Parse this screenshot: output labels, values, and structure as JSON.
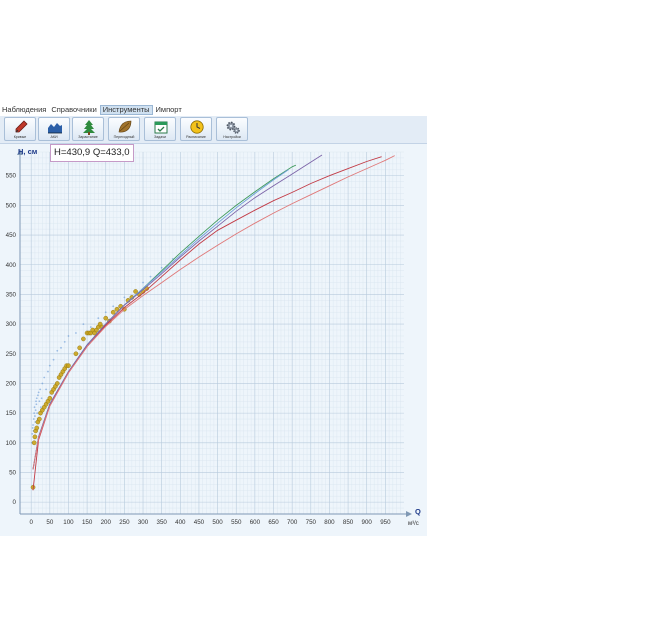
{
  "menu": {
    "items": [
      "Наблюдения",
      "Справочники",
      "Инструменты",
      "Импорт"
    ],
    "active_index": 2
  },
  "toolbar": {
    "buttons": [
      {
        "label": "Кривые",
        "icon": "pencil-icon"
      },
      {
        "label": "АКИ",
        "icon": "area-chart-icon"
      },
      {
        "label": "Зарастание",
        "icon": "tree-icon"
      },
      {
        "label": "Переходный",
        "icon": "leaf-icon"
      },
      {
        "label": "Задачи",
        "icon": "calendar-check-icon"
      },
      {
        "label": "Расписание",
        "icon": "clock-icon"
      },
      {
        "label": "Настройки",
        "icon": "gears-icon"
      }
    ]
  },
  "readout": {
    "text": "H=430,9 Q=433,0"
  },
  "colors": {
    "background": "#eef5fb",
    "grid_major": "#b7cadc",
    "grid_minor": "#d8e4ef",
    "axis": "#7f98b4",
    "axis_title": "#1f3b8a",
    "curve_green": "#3f9a5c",
    "curve_blue": "#6fa0d8",
    "curve_purple": "#7c64a8",
    "curve_red": "#c23b46",
    "curve_pink": "#e07878",
    "points_measured": "#c9a319",
    "points_scatter": "#5b8fd3"
  },
  "chart_data": {
    "type": "scatter",
    "title": "",
    "ylabel": "Н, см",
    "xlabel": "Q",
    "xlabel_unit": "м³/с",
    "xlim": [
      -30,
      1000
    ],
    "ylim": [
      -20,
      590
    ],
    "xticks": [
      0,
      50,
      100,
      150,
      200,
      250,
      300,
      350,
      400,
      450,
      500,
      550,
      600,
      650,
      700,
      750,
      800,
      850,
      900,
      950
    ],
    "yticks": [
      0,
      50,
      100,
      150,
      200,
      250,
      300,
      350,
      400,
      450,
      500,
      550
    ],
    "grid": true,
    "series": [
      {
        "color": "#3f9a5c",
        "kind": "line",
        "x": [
          5,
          20,
          50,
          100,
          150,
          200,
          250,
          300,
          350,
          400,
          450,
          500,
          550,
          600,
          650,
          700,
          710
        ],
        "y": [
          55,
          110,
          165,
          220,
          265,
          300,
          332,
          360,
          390,
          420,
          448,
          475,
          500,
          523,
          545,
          565,
          568
        ]
      },
      {
        "color": "#6fa0d8",
        "kind": "line",
        "x": [
          5,
          20,
          50,
          100,
          150,
          200,
          250,
          300,
          350,
          400,
          450,
          500,
          550,
          600,
          650,
          690
        ],
        "y": [
          55,
          110,
          165,
          220,
          265,
          300,
          332,
          360,
          388,
          416,
          444,
          470,
          496,
          520,
          543,
          560
        ]
      },
      {
        "color": "#7c64a8",
        "kind": "line",
        "x": [
          5,
          20,
          50,
          100,
          150,
          200,
          250,
          300,
          350,
          400,
          450,
          500,
          550,
          600,
          650,
          700,
          750,
          780
        ],
        "y": [
          55,
          110,
          165,
          220,
          265,
          300,
          332,
          358,
          385,
          413,
          440,
          465,
          490,
          513,
          533,
          553,
          573,
          585
        ]
      },
      {
        "color": "#c23b46",
        "kind": "line",
        "x": [
          5,
          20,
          50,
          100,
          150,
          200,
          250,
          300,
          350,
          400,
          450,
          500,
          550,
          600,
          650,
          700,
          750,
          800,
          850,
          900,
          940
        ],
        "y": [
          20,
          105,
          162,
          218,
          262,
          298,
          328,
          352,
          380,
          408,
          435,
          458,
          475,
          492,
          508,
          522,
          537,
          550,
          562,
          574,
          582
        ]
      },
      {
        "color": "#e07878",
        "kind": "line",
        "x": [
          5,
          20,
          50,
          100,
          150,
          200,
          250,
          300,
          350,
          400,
          450,
          500,
          550,
          600,
          650,
          700,
          750,
          800,
          850,
          900,
          950,
          975
        ],
        "y": [
          55,
          108,
          162,
          218,
          262,
          296,
          325,
          348,
          370,
          392,
          413,
          433,
          452,
          470,
          487,
          503,
          518,
          533,
          548,
          562,
          576,
          584
        ]
      },
      {
        "color": "#c9a319",
        "kind": "points",
        "x": [
          5,
          8,
          10,
          12,
          15,
          18,
          22,
          25,
          30,
          35,
          40,
          45,
          50,
          55,
          60,
          65,
          70,
          75,
          80,
          85,
          90,
          95,
          100,
          120,
          130,
          140,
          150,
          155,
          160,
          165,
          170,
          175,
          180,
          185,
          190,
          200,
          210,
          220,
          230,
          240,
          250,
          260,
          270,
          280,
          290,
          300,
          310
        ],
        "y": [
          25,
          100,
          110,
          120,
          125,
          135,
          140,
          150,
          155,
          160,
          165,
          170,
          175,
          185,
          190,
          195,
          200,
          210,
          215,
          220,
          225,
          230,
          230,
          250,
          260,
          275,
          285,
          285,
          285,
          290,
          285,
          290,
          295,
          300,
          295,
          310,
          305,
          320,
          325,
          330,
          325,
          340,
          345,
          355,
          350,
          355,
          360
        ]
      },
      {
        "color": "#5b8fd3",
        "kind": "points",
        "x": [
          2,
          3,
          4,
          5,
          6,
          7,
          8,
          9,
          10,
          11,
          12,
          13,
          14,
          15,
          16,
          17,
          18,
          20,
          22,
          24,
          26,
          28,
          30,
          35,
          40,
          45,
          50,
          60,
          70,
          80,
          90,
          100,
          120,
          140,
          160,
          180,
          200,
          220,
          250,
          280,
          300,
          320,
          350,
          380,
          420
        ],
        "y": [
          100,
          115,
          125,
          130,
          120,
          140,
          150,
          160,
          145,
          135,
          155,
          170,
          165,
          175,
          150,
          140,
          180,
          185,
          170,
          190,
          160,
          175,
          200,
          210,
          190,
          220,
          230,
          240,
          255,
          260,
          270,
          280,
          285,
          300,
          295,
          310,
          320,
          330,
          345,
          355,
          370,
          380,
          395,
          410,
          430
        ]
      }
    ]
  }
}
